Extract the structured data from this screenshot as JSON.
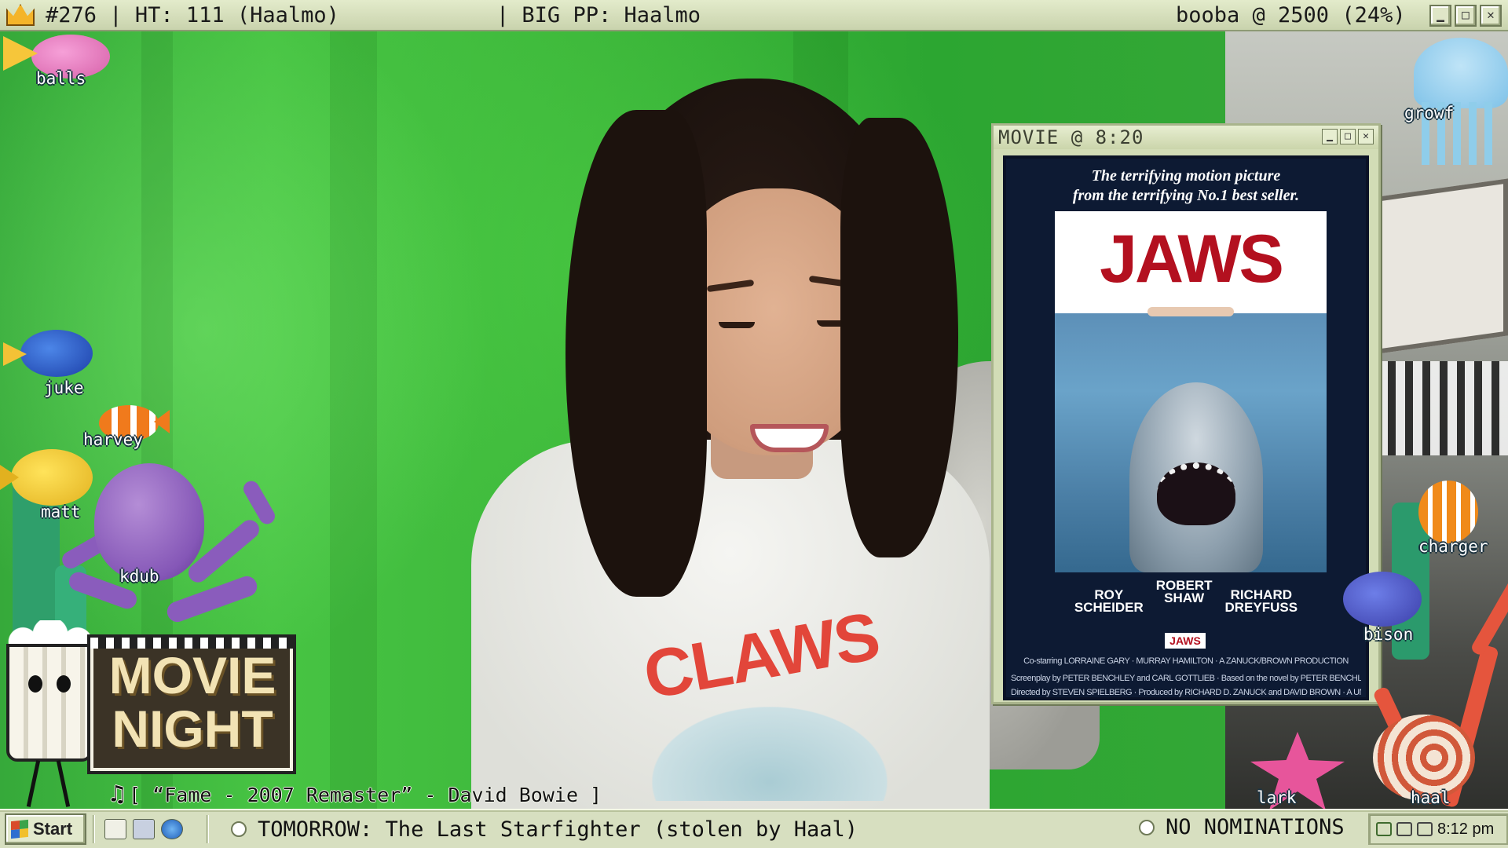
{
  "topbar": {
    "episode": "#276",
    "ht": "HT: 111 (Haalmo)",
    "big_pp": "BIG PP: Haalmo",
    "goal": "booba @ 2500 (24%)"
  },
  "movie_window": {
    "title": "MOVIE @ 8:20",
    "poster": {
      "tagline": "The terrifying motion picture\nfrom the terrifying No.1 best seller.",
      "logo": "JAWS",
      "credits": [
        "ROY\nSCHEIDER",
        "ROBERT\nSHAW",
        "RICHARD\nDREYFUSS"
      ],
      "small_logo": "JAWS",
      "fine_print": [
        "Co-starring LORRAINE GARY · MURRAY HAMILTON · A ZANUCK/BROWN PRODUCTION",
        "Screenplay by PETER BENCHLEY and CARL GOTTLIEB · Based on the novel by PETER BENCHLEY · Music by JOHN WILLIAMS",
        "Directed by STEVEN SPIELBERG · Produced by RICHARD D. ZANUCK and DAVID BROWN · A UNIVERSAL PICTURE"
      ]
    }
  },
  "creatures": {
    "balls": "balls",
    "juke": "juke",
    "harvey": "harvey",
    "matt": "matt",
    "kdub": "kdub",
    "growf": "growf",
    "charger": "charger",
    "bison": "bison",
    "lark": "lark",
    "haal": "haal"
  },
  "shirt_print": "CLAWS",
  "movie_night_logo": "MOVIE\nNIGHT",
  "now_playing": "[ “Fame - 2007 Remaster” - David Bowie ]",
  "taskbar": {
    "start_label": "Start",
    "ticker": "TOMORROW: The Last Starfighter (stolen by Haal)",
    "nomination": "NO NOMINATIONS",
    "clock": "8:12 pm"
  },
  "colors": {
    "greenscreen": "#3fb83a",
    "chrome": "#d7dfc0",
    "poster_navy": "#0d1a33",
    "jaws_red": "#b3101f"
  }
}
